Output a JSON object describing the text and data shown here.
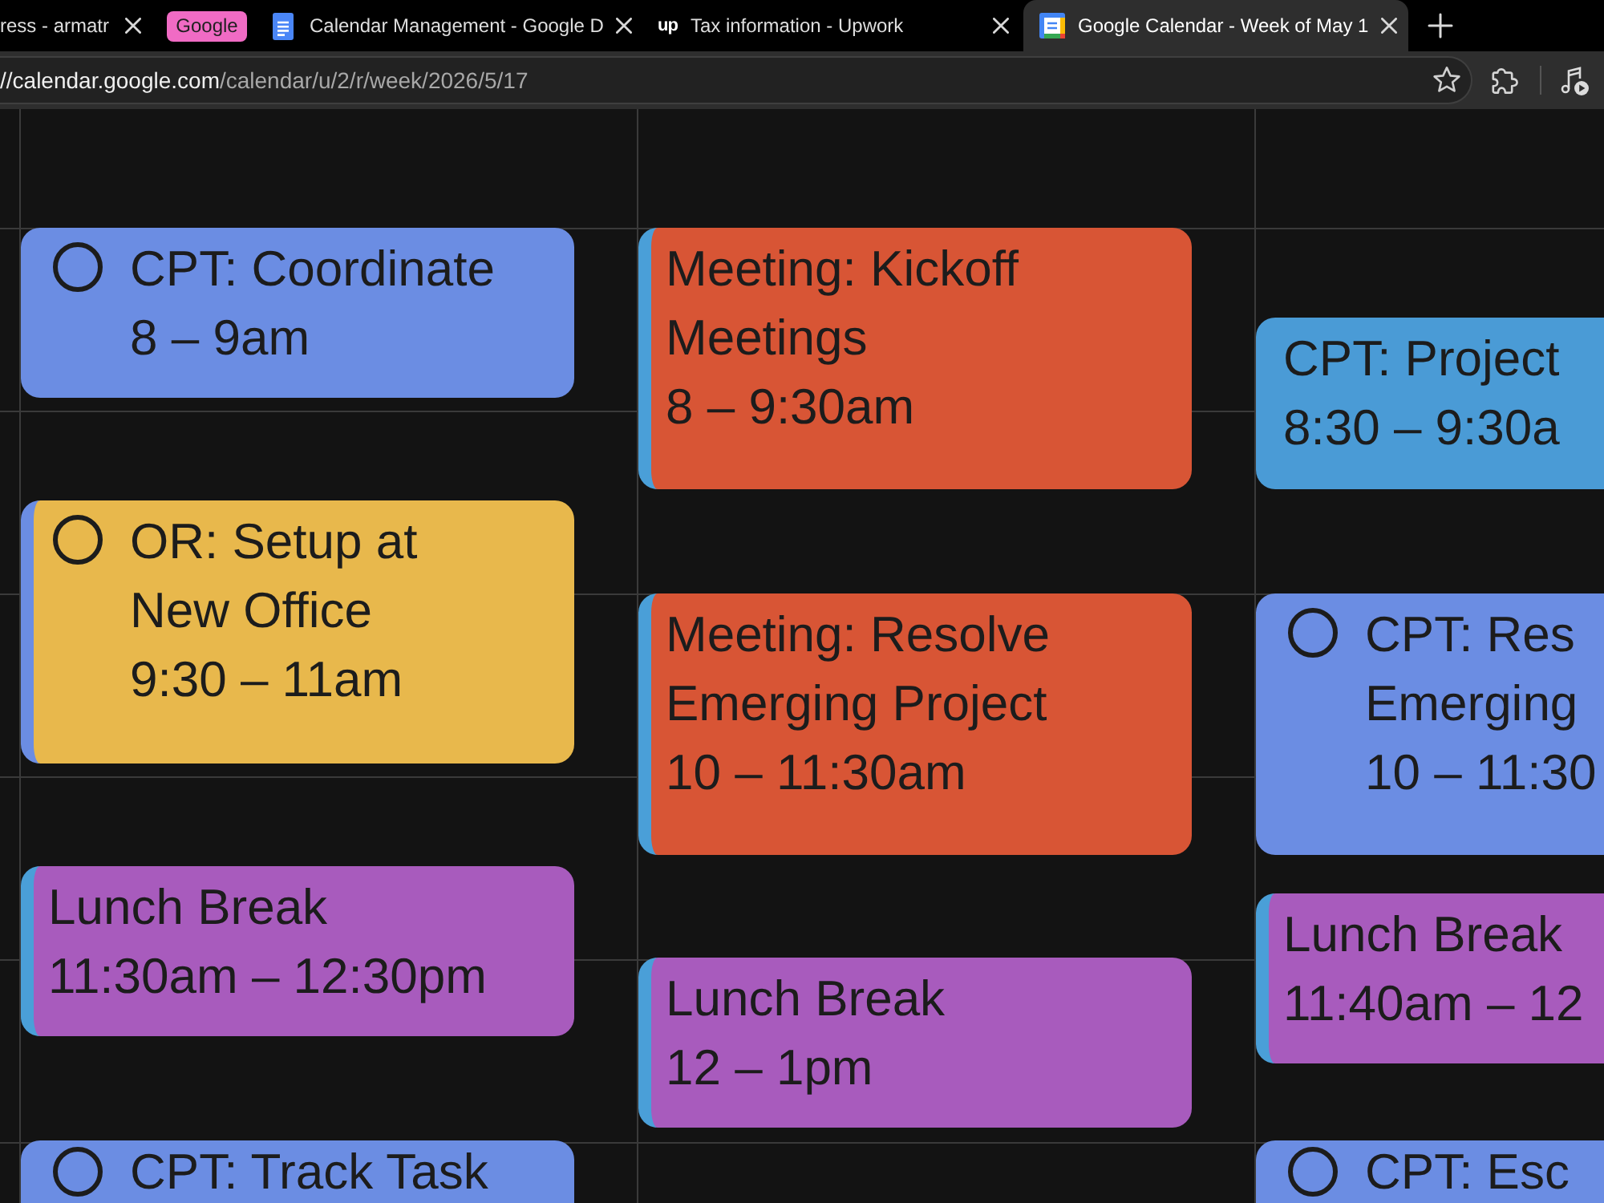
{
  "tab_strip": {
    "items": [
      {
        "kind": "tab",
        "title": "ress - armatr",
        "selected": false
      },
      {
        "kind": "group",
        "label": "Google",
        "color": "#f06bc4"
      },
      {
        "kind": "tab",
        "title": "Calendar Management - Google D",
        "selected": false
      },
      {
        "kind": "tab",
        "title": "Tax information - Upwork",
        "icon_text": "up",
        "selected": false
      },
      {
        "kind": "tab",
        "title": "Google Calendar - Week of May 1",
        "selected": true
      }
    ]
  },
  "toolbar": {
    "url_host": "//calendar.google.com",
    "url_path": "/calendar/u/2/r/week/2026/5/17"
  },
  "calendar": {
    "columns": [
      {
        "events": [
          {
            "kind": "task",
            "title": "CPT: Coordinate",
            "time": "8 – 9am",
            "color": "#6b8de3"
          },
          {
            "kind": "task",
            "title": "OR: Setup at New Office",
            "time": "9:30 – 11am",
            "color": "#e8b84c",
            "stripe": {
              "color": "#6b8de3"
            }
          },
          {
            "kind": "event",
            "title": "Lunch Break",
            "time": "11:30am – 12:30pm",
            "color": "#a85bbd",
            "stripe": {
              "color": "#4a9fd8"
            }
          },
          {
            "kind": "task",
            "title": "CPT: Track Task",
            "color": "#6b8de3"
          }
        ]
      },
      {
        "events": [
          {
            "kind": "event",
            "title": "Meeting: Kickoff Meetings",
            "time": "8 – 9:30am",
            "color": "#d85535",
            "stripe": {
              "color": "#4a9fd8"
            }
          },
          {
            "kind": "event",
            "title": "Meeting: Resolve Emerging Project",
            "time": "10 – 11:30am",
            "color": "#d85535",
            "stripe": {
              "color": "#4a9fd8"
            }
          },
          {
            "kind": "event",
            "title": "Lunch Break",
            "time": "12 – 1pm",
            "color": "#a85bbd",
            "stripe": {
              "color": "#4a9fd8"
            }
          }
        ]
      },
      {
        "events": [
          {
            "kind": "event",
            "title": "CPT: Project",
            "time": "8:30 – 9:30a",
            "color": "#4a9bd6"
          },
          {
            "kind": "task",
            "title": "CPT: Res Emerging",
            "time": "10 – 11:30",
            "color": "#6b8de3"
          },
          {
            "kind": "event",
            "title": "Lunch Break",
            "time": "11:40am – 12",
            "color": "#a85bbd",
            "stripe": {
              "color": "#4a9fd8"
            }
          },
          {
            "kind": "task",
            "title": "CPT: Esc",
            "color": "#6b8de3"
          }
        ]
      }
    ]
  }
}
